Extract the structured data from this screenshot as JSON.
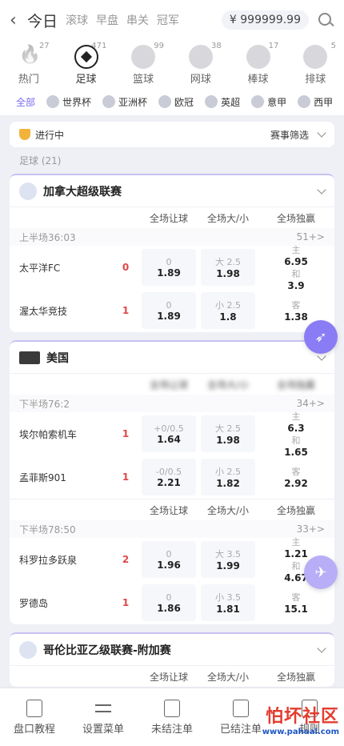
{
  "header": {
    "back_icon": "chevron-left-icon",
    "title": "今日",
    "tabs": [
      "滚球",
      "早盘",
      "串关",
      "冠军"
    ],
    "balance": "¥ 999999.99"
  },
  "sports": [
    {
      "name": "热门",
      "count": "27",
      "icon": "flame-icon"
    },
    {
      "name": "足球",
      "count": "471",
      "icon": "soccer-icon"
    },
    {
      "name": "篮球",
      "count": "99",
      "icon": "basketball-icon"
    },
    {
      "name": "网球",
      "count": "38",
      "icon": "tennis-icon"
    },
    {
      "name": "棒球",
      "count": "17",
      "icon": "baseball-icon"
    },
    {
      "name": "排球",
      "count": "5",
      "icon": "volleyball-icon"
    }
  ],
  "leagues": [
    "全部",
    "世界杯",
    "亚洲杯",
    "欧冠",
    "英超",
    "意甲",
    "西甲"
  ],
  "filter": {
    "live": "进行中",
    "screen": "赛事筛选"
  },
  "section": "足球 (21)",
  "cols": [
    "全场让球",
    "全场大/小",
    "全场独赢"
  ],
  "cards": [
    {
      "league": "加拿大超级联赛",
      "period": "上半场36:03",
      "more": "51+>",
      "home": {
        "name": "太平洋FC",
        "score": "0",
        "hcap_h": "0",
        "hcap_v": "1.89",
        "ou_h": "大 2.5",
        "ou_v": "1.98",
        "w_h": "主",
        "w_v": "6.95"
      },
      "draw": {
        "h": "和",
        "v": "3.9"
      },
      "away": {
        "name": "渥太华竞技",
        "score": "1",
        "hcap_h": "0",
        "hcap_v": "1.89",
        "ou_h": "小 2.5",
        "ou_v": "1.8",
        "w_h": "客",
        "w_v": "1.38"
      }
    },
    {
      "league": "美国",
      "period": "下半场76:2",
      "more": "34+>",
      "home": {
        "name": "埃尔帕索机车",
        "score": "1",
        "hcap_h": "+0/0.5",
        "hcap_v": "1.64",
        "ou_h": "大 2.5",
        "ou_v": "1.98",
        "w_h": "主",
        "w_v": "6.3"
      },
      "draw": {
        "h": "和",
        "v": "1.65"
      },
      "away": {
        "name": "孟菲斯901",
        "score": "1",
        "hcap_h": "-0/0.5",
        "hcap_v": "2.21",
        "ou_h": "小 2.5",
        "ou_v": "1.82",
        "w_h": "客",
        "w_v": "2.92"
      }
    },
    {
      "league": "",
      "period": "下半场78:50",
      "more": "33+>",
      "home": {
        "name": "科罗拉多跃泉",
        "score": "2",
        "hcap_h": "0",
        "hcap_v": "1.96",
        "ou_h": "大 3.5",
        "ou_v": "1.99",
        "w_h": "主",
        "w_v": "1.21"
      },
      "draw": {
        "h": "和",
        "v": "4.67"
      },
      "away": {
        "name": "罗德岛",
        "score": "1",
        "hcap_h": "0",
        "hcap_v": "1.86",
        "ou_h": "小 3.5",
        "ou_v": "1.81",
        "w_h": "客",
        "w_v": "15.1"
      }
    },
    {
      "league": "哥伦比亚乙级联赛-附加赛"
    }
  ],
  "bottom": [
    "盘口教程",
    "设置菜单",
    "未结注单",
    "已结注单",
    "规则"
  ],
  "watermark": {
    "line1": "怕坏社区",
    "line2": "www.pahual.com"
  }
}
